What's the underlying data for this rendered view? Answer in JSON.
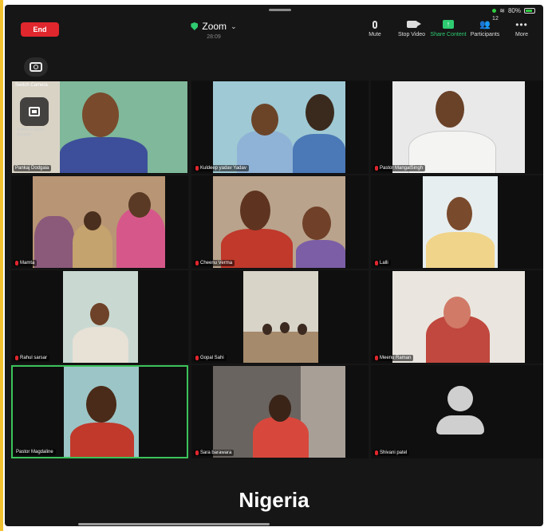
{
  "header": {
    "end_label": "End",
    "app_title": "Zoom",
    "timer": "28:09",
    "status": {
      "battery": "80%"
    }
  },
  "toolbar": {
    "mute_label": "Mute",
    "stop_video_label": "Stop Video",
    "share_label": "Share Content",
    "participants_label": "Participants",
    "participants_count": "12",
    "more_label": "More"
  },
  "overlay": {
    "switch_camera": "Switch Camera",
    "speaker_caption": "Switch to Active Speaker"
  },
  "participants": [
    {
      "name": "Pankaj Dodgaia"
    },
    {
      "name": "Kuldeep yadav Yadav"
    },
    {
      "name": "Pastor MangalSingh"
    },
    {
      "name": "Mamta"
    },
    {
      "name": "Cheenu Verma"
    },
    {
      "name": "Lalli"
    },
    {
      "name": "Rahul sarsar"
    },
    {
      "name": "Gopal Sahi"
    },
    {
      "name": "Meenu Raman"
    },
    {
      "name": "Pastor Magdaline"
    },
    {
      "name": "Sara barawara"
    },
    {
      "name": "Shivani patel"
    }
  ],
  "caption": "Nigeria",
  "colors": {
    "end": "#e0272d",
    "share": "#2ecc71",
    "active_border": "#3bc35a"
  }
}
